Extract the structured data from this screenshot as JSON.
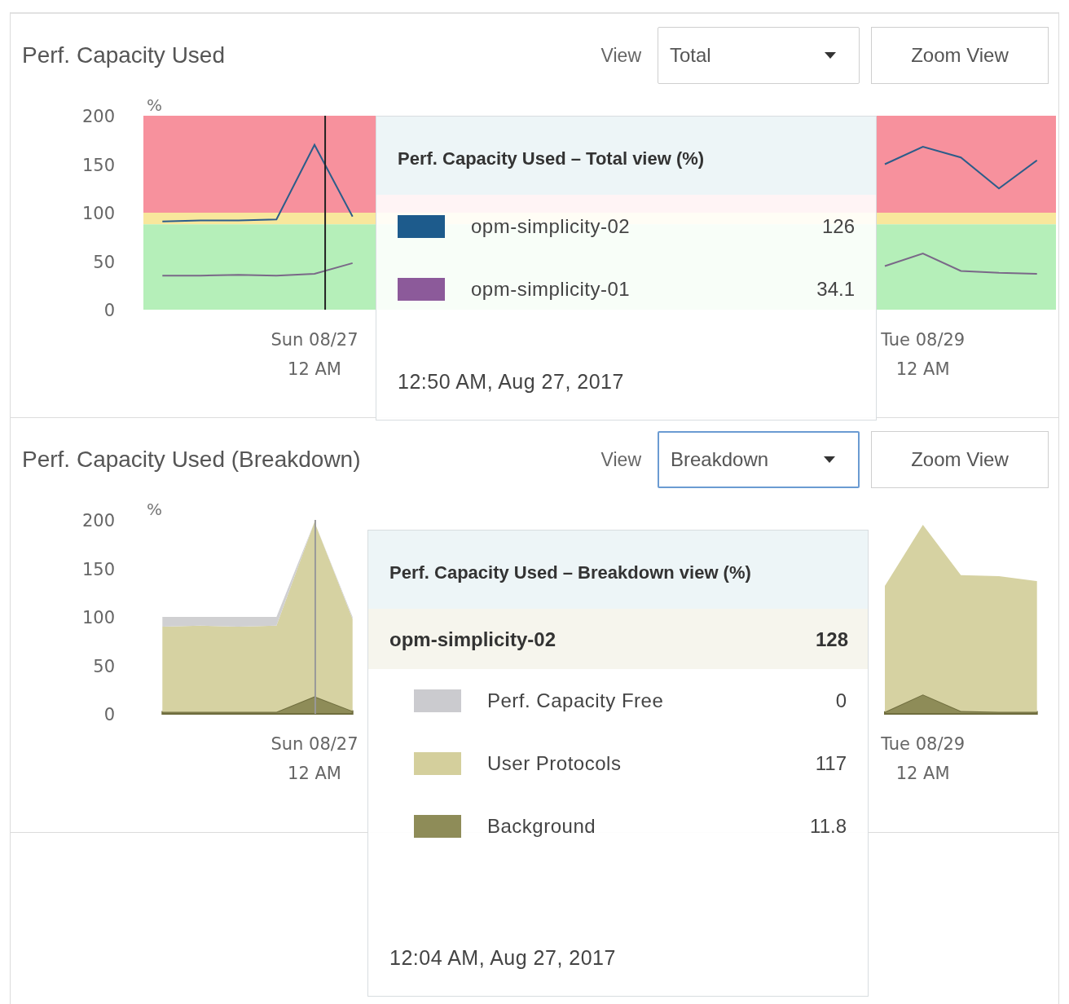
{
  "panels": [
    {
      "title": "Perf. Capacity Used",
      "view_label": "View",
      "view_select": {
        "value": "Total",
        "focused": false
      },
      "zoom_button": "Zoom View",
      "chart_data": {
        "type": "line",
        "ylabel": "%",
        "ylim": [
          0,
          200
        ],
        "yticks": [
          0,
          50,
          100,
          150,
          200
        ],
        "categories": [
          null,
          null,
          null,
          null,
          "Sun 08/27\n12 AM",
          null,
          null,
          null,
          null,
          null,
          null,
          null,
          null,
          null,
          null,
          null,
          null,
          null,
          null,
          null,
          "Tue 08/29\n12 AM",
          null,
          null,
          null
        ],
        "series": [
          {
            "color": "#2c5d8a",
            "values": [
              91,
              92,
              92,
              93,
              170,
              96,
              null,
              null,
              null,
              null,
              null,
              null,
              null,
              null,
              null,
              null,
              null,
              null,
              null,
              150,
              168,
              157,
              125,
              154
            ]
          },
          {
            "color": "#7a6888",
            "values": [
              35,
              35,
              36,
              35,
              37,
              48,
              null,
              null,
              null,
              null,
              null,
              null,
              null,
              null,
              null,
              null,
              null,
              null,
              null,
              45,
              58,
              40,
              38,
              37
            ]
          }
        ],
        "bands": [
          {
            "axis": "y",
            "from": 100,
            "to": 200,
            "color": "#f7919d"
          },
          {
            "axis": "y",
            "from": 88,
            "to": 100,
            "color": "#f8e79c"
          },
          {
            "axis": "y",
            "from": 0,
            "to": 88,
            "color": "#b5efb9"
          }
        ]
      },
      "tooltip": {
        "title": "Perf. Capacity Used – Total view (%)",
        "rows": [
          {
            "name": "opm-simplicity-02",
            "value": "126",
            "color": "#1d5b8c"
          },
          {
            "name": "opm-simplicity-01",
            "value": "34.1",
            "color": "#8c5a9a"
          }
        ],
        "time": "12:50 AM, Aug 27, 2017"
      }
    },
    {
      "title": "Perf. Capacity Used (Breakdown)",
      "view_label": "View",
      "view_select": {
        "value": "Breakdown",
        "focused": true
      },
      "zoom_button": "Zoom View",
      "chart_data": {
        "type": "area",
        "stacked": true,
        "ylabel": "%",
        "ylim": [
          0,
          200
        ],
        "yticks": [
          0,
          50,
          100,
          150,
          200
        ],
        "categories": [
          null,
          null,
          null,
          null,
          "Sun 08/27\n12 AM",
          null,
          null,
          null,
          null,
          null,
          null,
          null,
          null,
          null,
          null,
          null,
          null,
          null,
          null,
          null,
          "Tue 08/29\n12 AM",
          null,
          null,
          null
        ],
        "series": [
          {
            "color": "#8e8c58",
            "values": [
              2,
              2,
              2,
              2,
              18,
              3,
              null,
              null,
              null,
              null,
              null,
              null,
              null,
              null,
              null,
              null,
              null,
              null,
              null,
              2,
              20,
              3,
              2,
              2
            ]
          },
          {
            "color": "#d6d2a2",
            "values": [
              88,
              89,
              88,
              89,
              180,
              95,
              null,
              null,
              null,
              null,
              null,
              null,
              null,
              null,
              null,
              null,
              null,
              null,
              null,
              130,
              175,
              140,
              140,
              135
            ]
          },
          {
            "color": "#d0d0d2",
            "values": [
              10,
              9,
              10,
              9,
              0,
              2,
              null,
              null,
              null,
              null,
              null,
              null,
              null,
              null,
              null,
              null,
              null,
              null,
              null,
              null,
              null,
              null,
              null,
              null
            ]
          }
        ]
      },
      "tooltip": {
        "title": "Perf. Capacity Used – Breakdown view (%)",
        "group": {
          "name": "opm-simplicity-02",
          "value": "128"
        },
        "rows": [
          {
            "name": "Perf. Capacity Free",
            "value": "0",
            "color": "#cbcbcf"
          },
          {
            "name": "User Protocols",
            "value": "117",
            "color": "#d4cf9c"
          },
          {
            "name": "Background",
            "value": "11.8",
            "color": "#8e8c58"
          }
        ],
        "time": "12:04 AM, Aug 27, 2017"
      }
    }
  ]
}
